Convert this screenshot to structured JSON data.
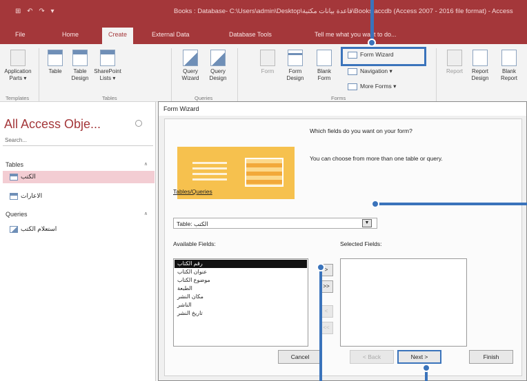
{
  "titlebar": {
    "quick_access": "⊞ ↶ ↷ ▾",
    "title": "Books : Database- C:\\Users\\admin\\Desktop\\قاعدة بيانات مكتبة\\Books.accdb (Access 2007 - 2016 file format) - Access"
  },
  "tabs": [
    "File",
    "Home",
    "Create",
    "External Data",
    "Database Tools",
    "Tell me what you want to do..."
  ],
  "ribbon": {
    "app_parts": "Application\nParts ▾",
    "table": "Table",
    "table_design": "Table\nDesign",
    "sharepoint": "SharePoint\nLists ▾",
    "query_wizard": "Query\nWizard",
    "query_design": "Query\nDesign",
    "form": "Form",
    "form_design": "Form\nDesign",
    "blank_form": "Blank\nForm",
    "form_wizard": "Form Wizard",
    "navigation": "Navigation ▾",
    "more_forms": "More Forms ▾",
    "report": "Report",
    "report_design": "Report\nDesign",
    "blank_report": "Blank\nReport",
    "groups": [
      "Templates",
      "Tables",
      "Queries",
      "Forms"
    ]
  },
  "navpane": {
    "title": "All Access Obje...",
    "search_placeholder": "Search...",
    "sections": [
      {
        "label": "Tables",
        "items": [
          "الكتب",
          "الاعارات"
        ]
      },
      {
        "label": "Queries",
        "items": [
          "استعلام الكتب"
        ]
      }
    ]
  },
  "dialog": {
    "title": "Form Wizard",
    "question": "Which fields do you want on your form?",
    "hint": "You can choose from more than one table or query.",
    "tables_label": "Tables/Queries",
    "tables_value": "Table: الكتب",
    "available_label": "Available Fields:",
    "selected_label": "Selected Fields:",
    "available_fields": [
      "رقم الكتاب",
      "عنوان الكتاب",
      "موضوع الكتاب",
      "الطبعة",
      "مكان النشر",
      "الناشر",
      "تاريخ النشر"
    ],
    "move_buttons": [
      ">",
      ">>",
      "<",
      "<<"
    ],
    "buttons": {
      "cancel": "Cancel",
      "back": "< Back",
      "next": "Next >",
      "finish": "Finish"
    }
  },
  "colors": {
    "accent": "#a4373a",
    "callout": "#3a73bb",
    "selected_nav": "#f3cdd3"
  }
}
